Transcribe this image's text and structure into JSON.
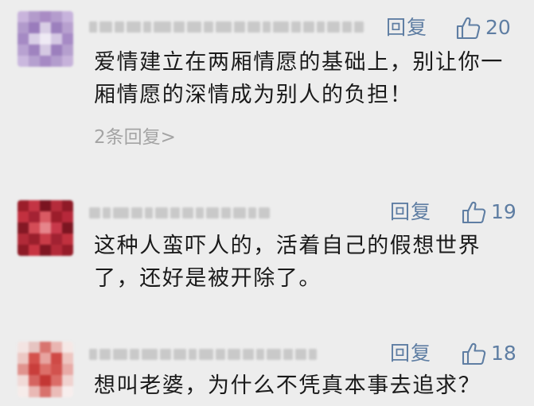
{
  "comments": [
    {
      "reply_label": "回复",
      "likes": "20",
      "text": "爱情建立在两厢情愿的基础上，别让你一厢情愿的深情成为别人的负担！",
      "replies_link": "2条回复>"
    },
    {
      "reply_label": "回复",
      "likes": "19",
      "text": "这种人蛮吓人的，活着自己的假想世界了，还好是被开除了。"
    },
    {
      "reply_label": "回复",
      "likes": "18",
      "text": "想叫老婆，为什么不凭真本事去追求？"
    }
  ],
  "colors": {
    "background": "#ededed",
    "accent": "#5f7ea3",
    "text": "#1a1a1a",
    "muted": "#a4a4a4"
  },
  "icons": {
    "like": "thumbs-up-icon"
  }
}
